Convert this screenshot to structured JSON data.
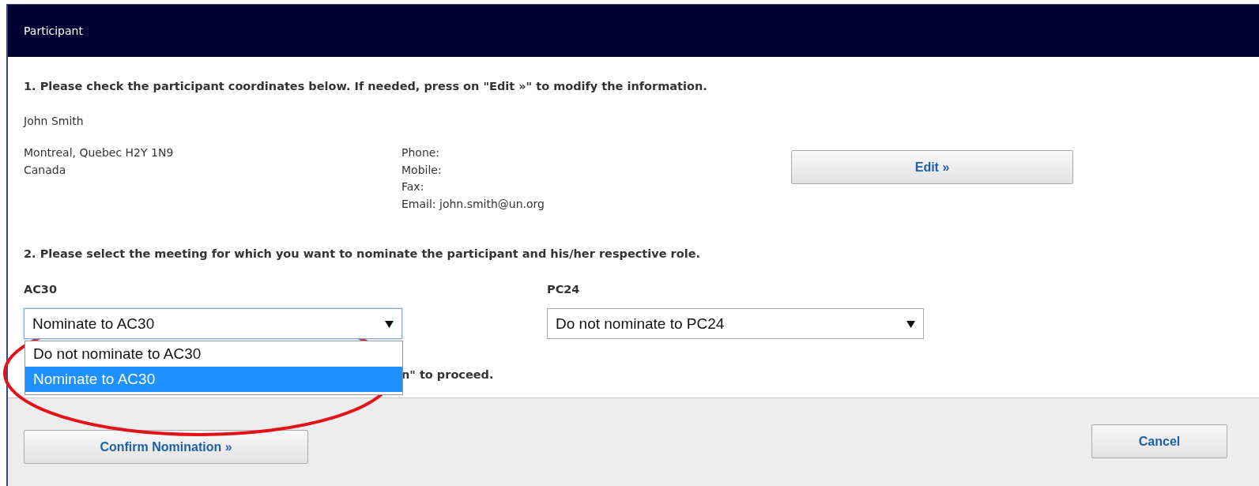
{
  "window": {
    "title": "Participant"
  },
  "step1": {
    "heading": "1. Please check the participant coordinates below. If needed, press on \"Edit »\" to modify the information.",
    "name": "John Smith",
    "address": [
      "Montreal, Quebec H2Y 1N9",
      "Canada"
    ],
    "contacts": [
      "Phone:",
      "Mobile:",
      "Fax:",
      "Email: john.smith@un.org"
    ],
    "edit_button": "Edit »"
  },
  "step2": {
    "heading": "2. Please select the meeting for which you want to nominate the participant and his/her respective role.",
    "meetings": [
      {
        "label": "AC30",
        "value": "Nominate to AC30",
        "expanded": true,
        "options": [
          {
            "label": "Do not nominate to AC30",
            "selected": false
          },
          {
            "label": "Nominate to AC30",
            "selected": true
          }
        ]
      },
      {
        "label": "PC24",
        "value": "Do not nominate to PC24",
        "expanded": false
      }
    ],
    "instruction": "n\" to proceed."
  },
  "footer": {
    "buttons": [
      {
        "label": "Confirm Nomination »",
        "kind": "confirm"
      },
      {
        "label": "Cancel",
        "kind": "cancel"
      }
    ]
  }
}
